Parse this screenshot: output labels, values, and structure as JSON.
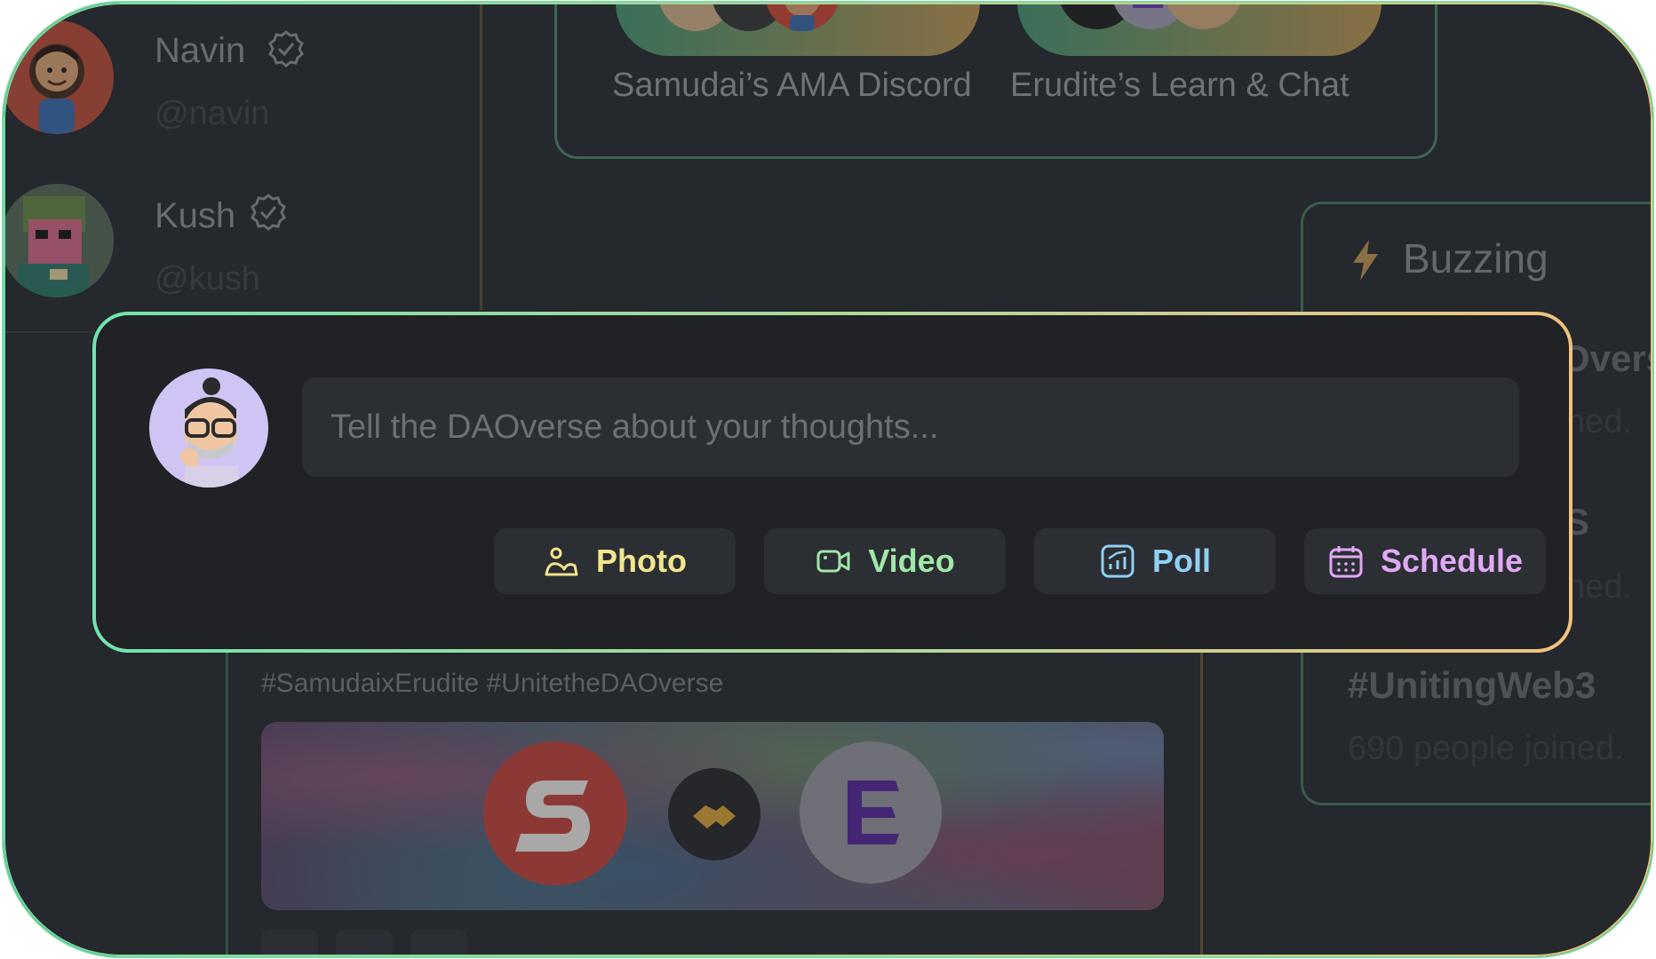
{
  "sidebar": {
    "users": [
      {
        "name": "Navin",
        "handle": "@navin"
      },
      {
        "name": "Kush",
        "handle": "@kush"
      }
    ]
  },
  "communities": [
    {
      "label": "Samudai’s AMA Discord"
    },
    {
      "label": "Erudite’s Learn & Chat"
    }
  ],
  "buzzing": {
    "title": "Buzzing",
    "items": [
      {
        "tag": "Overs",
        "sub": "ned."
      },
      {
        "tag": "S",
        "sub": "ned."
      },
      {
        "tag": "#UnitingWeb3",
        "sub": "690 people joined."
      }
    ]
  },
  "post": {
    "hashtags": "#SamudaixErudite  #UnitetheDAOverse"
  },
  "composer": {
    "placeholder": "Tell the DAOverse about your thoughts...",
    "buttons": {
      "photo": "Photo",
      "video": "Video",
      "poll": "Poll",
      "schedule": "Schedule"
    }
  },
  "colors": {
    "photo": "#f2e58c",
    "video": "#9fe8a8",
    "poll": "#8fd0f5",
    "schedule": "#e0a8f5",
    "border_start": "#72e3b0",
    "border_end": "#f0c27e"
  },
  "icons": {
    "photo": "image-icon",
    "video": "video-camera-icon",
    "poll": "chart-icon",
    "schedule": "calendar-icon",
    "verified": "verified-badge-icon",
    "buzzing": "lightning-bolt-icon"
  }
}
